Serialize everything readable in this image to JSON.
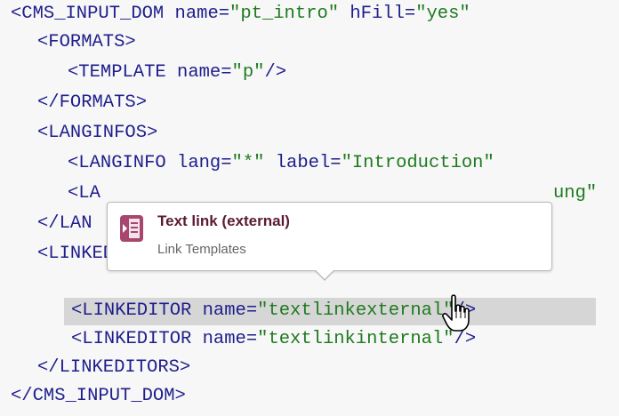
{
  "code_lines": [
    {
      "indent": 0,
      "tag_open": "<CMS_INPUT_DOM",
      "attr1": " name=",
      "val1": "\"pt_intro\"",
      "attr2": " hFill=",
      "val2": "\"yes\"",
      "tag_close": ""
    },
    {
      "indent": 1,
      "tag_open": "<FORMATS>"
    },
    {
      "indent": 2,
      "tag_open": "<TEMPLATE",
      "attr1": " name=",
      "val1": "\"p\"",
      "tag_close": "/>"
    },
    {
      "indent": 1,
      "tag_open": "</FORMATS>"
    },
    {
      "indent": 1,
      "tag_open": "<LANGINFOS>"
    },
    {
      "indent": 2,
      "tag_open": "<LANGINFO",
      "attr1": " lang=",
      "val1": "\"*\"",
      "attr2": " label=",
      "val2": "\"Introduction\""
    },
    {
      "indent": 2,
      "tag_open": "<LA",
      "tail_visible": "ung\""
    },
    {
      "indent": 1,
      "tag_open": "</LAN"
    },
    {
      "indent": 1,
      "tag_open": "<LINKEDITORS>"
    },
    {
      "indent": 2,
      "tag_open": "<LINKEDITOR",
      "attr1": " name=",
      "val1": "\"textlinkexternal\"",
      "tag_close": "/>"
    },
    {
      "indent": 2,
      "tag_open": "<LINKEDITOR",
      "attr1": " name=",
      "val1": "\"textlinkinternal\"",
      "tag_close": "/>"
    },
    {
      "indent": 1,
      "tag_open": "</LINKEDITORS>"
    },
    {
      "indent": 0,
      "tag_open": "</CMS_INPUT_DOM>"
    }
  ],
  "tooltip": {
    "title": "Text link (external)",
    "subtitle": "Link Templates",
    "icon": "link-template-icon"
  },
  "cursor": "hand-pointer-icon",
  "colors": {
    "tag": "#1e1e8c",
    "value": "#1f7a1f",
    "highlight": "#d6d6d6",
    "tooltip_title": "#5a1a33",
    "icon_accent": "#a8466e"
  }
}
